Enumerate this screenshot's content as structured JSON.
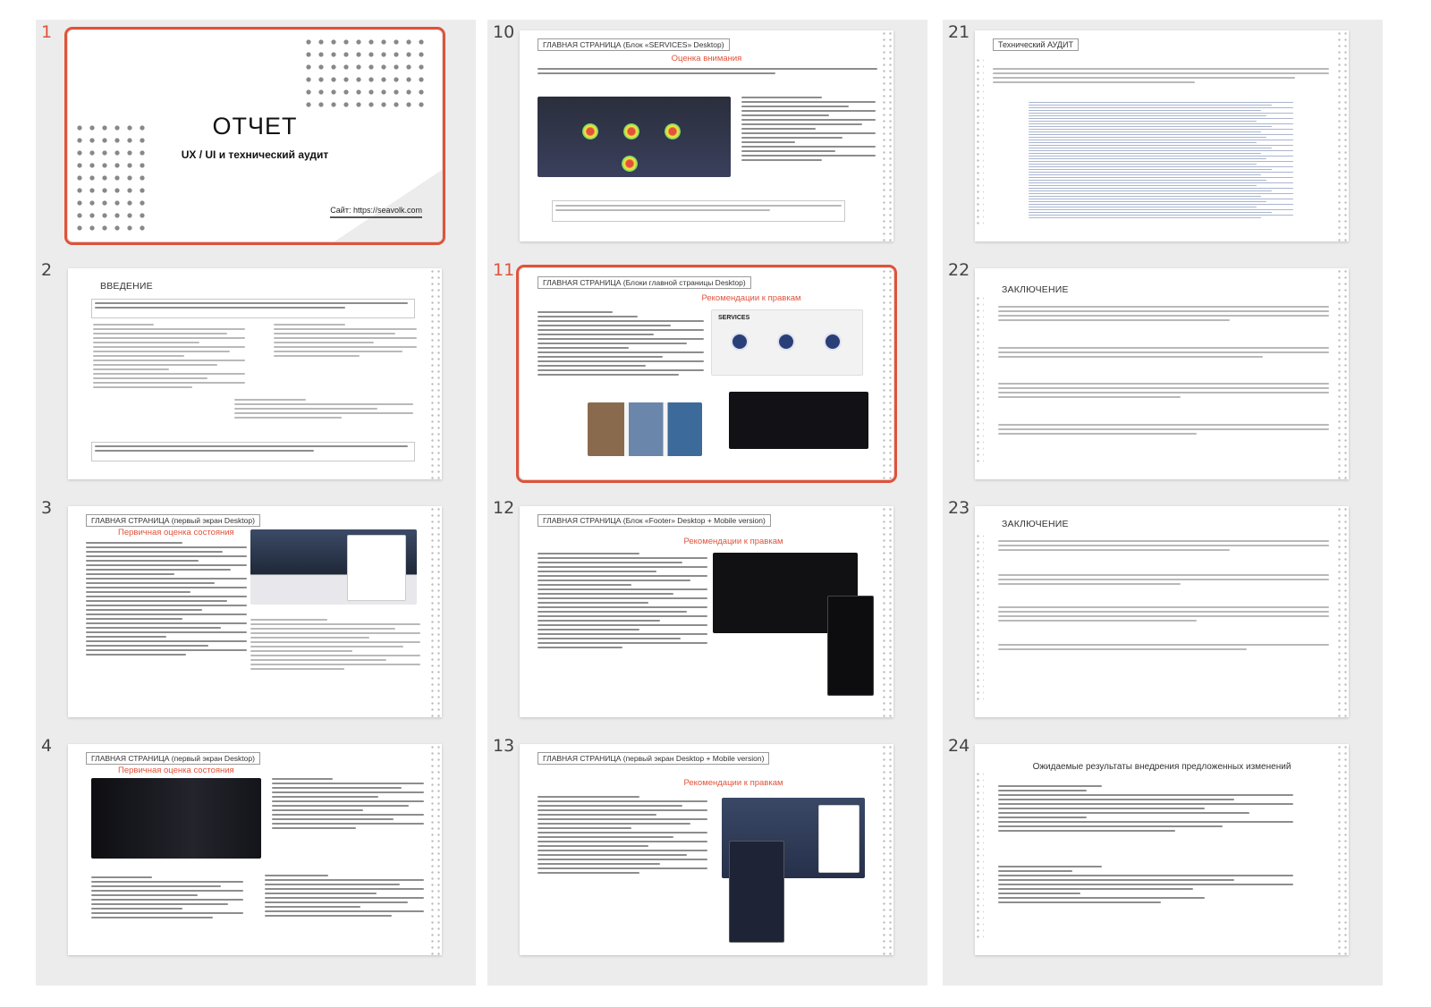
{
  "slides": {
    "s1": {
      "num": "1",
      "title": "ОТЧЕТ",
      "subtitle": "UX / UI и технический аудит",
      "site": "Сайт: https://seavolk.com"
    },
    "s2": {
      "num": "2",
      "title": "ВВЕДЕНИЕ"
    },
    "s3": {
      "num": "3",
      "title": "ГЛАВНАЯ СТРАНИЦА (первый экран Desktop)",
      "subtitle": "Первичная оценка состояния"
    },
    "s4": {
      "num": "4",
      "title": "ГЛАВНАЯ СТРАНИЦА (первый экран Desktop)",
      "subtitle": "Первичная оценка состояния"
    },
    "s10": {
      "num": "10",
      "title": "ГЛАВНАЯ СТРАНИЦА (Блок «SERVICES» Desktop)",
      "subtitle": "Оценка внимания"
    },
    "s11": {
      "num": "11",
      "title": "ГЛАВНАЯ СТРАНИЦА (Блоки главной страницы Desktop)",
      "subtitle": "Рекомендации к правкам",
      "services": "SERVICES"
    },
    "s12": {
      "num": "12",
      "title": "ГЛАВНАЯ СТРАНИЦА (Блок «Footer» Desktop + Mobile version)",
      "subtitle": "Рекомендации к правкам"
    },
    "s13": {
      "num": "13",
      "title": "ГЛАВНАЯ СТРАНИЦА (первый экран Desktop + Mobile version)",
      "subtitle": "Рекомендации к правкам"
    },
    "s21": {
      "num": "21",
      "title": "Технический АУДИТ"
    },
    "s22": {
      "num": "22",
      "title": "ЗАКЛЮЧЕНИЕ"
    },
    "s23": {
      "num": "23",
      "title": "ЗАКЛЮЧЕНИЕ"
    },
    "s24": {
      "num": "24",
      "title": "Ожидаемые результаты внедрения предложенных изменений"
    }
  },
  "colors": {
    "accent": "#e0523a",
    "panel": "#ececec"
  },
  "selected_slides": [
    "1",
    "11"
  ]
}
